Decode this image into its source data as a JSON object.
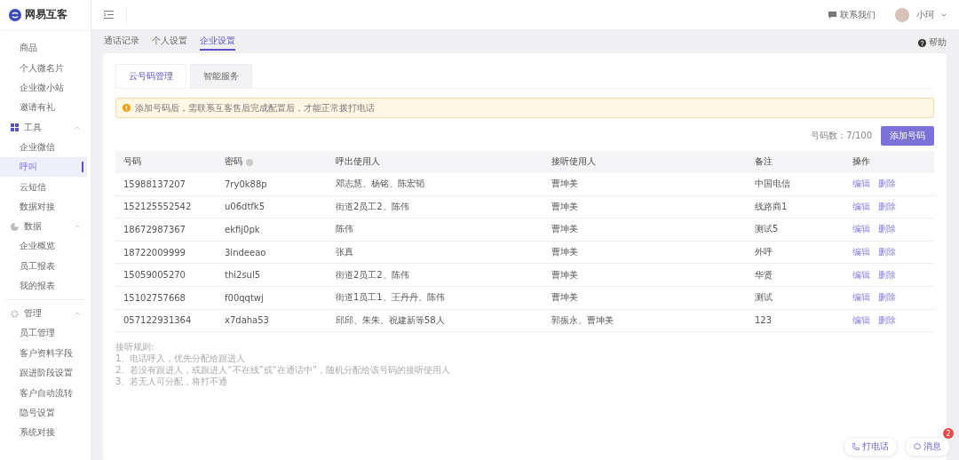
{
  "brand": {
    "name": "网易互客"
  },
  "header": {
    "contact": "联系我们",
    "user": "小珂"
  },
  "sidebar": {
    "sections": [
      {
        "items": [
          {
            "label": "商品",
            "selected": false
          },
          {
            "label": "个人微名片",
            "selected": false
          },
          {
            "label": "企业微小站",
            "selected": false
          },
          {
            "label": "邀请有礼",
            "selected": false
          }
        ]
      },
      {
        "title": "工具",
        "expanded": true,
        "items": [
          {
            "label": "企业微信",
            "selected": false
          },
          {
            "label": "呼叫",
            "selected": true
          },
          {
            "label": "云短信",
            "selected": false
          },
          {
            "label": "数据对接",
            "selected": false
          }
        ]
      },
      {
        "title": "数据",
        "expanded": true,
        "items": [
          {
            "label": "企业概览",
            "selected": false
          },
          {
            "label": "员工报表",
            "selected": false
          },
          {
            "label": "我的报表",
            "selected": false
          }
        ]
      },
      {
        "title": "管理",
        "expanded": true,
        "items": [
          {
            "label": "员工管理",
            "selected": false
          },
          {
            "label": "客户资料字段",
            "selected": false
          },
          {
            "label": "跟进阶段设置",
            "selected": false
          },
          {
            "label": "客户自动流转",
            "selected": false
          },
          {
            "label": "隐号设置",
            "selected": false
          },
          {
            "label": "系统对接",
            "selected": false
          }
        ]
      }
    ]
  },
  "page_tabs": [
    {
      "label": "通话记录",
      "selected": false
    },
    {
      "label": "个人设置",
      "selected": false
    },
    {
      "label": "企业设置",
      "selected": true
    }
  ],
  "help": "帮助",
  "card_tabs": [
    {
      "label": "云号码管理",
      "selected": true
    },
    {
      "label": "智能服务",
      "selected": false
    }
  ],
  "alert": "添加号码后，需联系互客售后完成配置后，才能正常拨打电话",
  "count": {
    "label": "号码数：",
    "value": "7/100"
  },
  "add_button": "添加号码",
  "table": {
    "columns": [
      "号码",
      "密码",
      "呼出使用人",
      "接听使用人",
      "备注",
      "操作"
    ],
    "rows": [
      {
        "cells": [
          "15988137207",
          "7ry0k88p",
          "邓志慧、杨铭、陈宏韬",
          "曹坤美",
          "中国电信"
        ],
        "actions": [
          "编辑",
          "删除"
        ]
      },
      {
        "cells": [
          "152125552542",
          "u06dtfk5",
          "街道2员工2、陈伟",
          "曹坤美",
          "线路商1"
        ],
        "actions": [
          "编辑",
          "删除"
        ]
      },
      {
        "cells": [
          "18672987367",
          "ekfij0pk",
          "陈伟",
          "曹坤美",
          "测试5"
        ],
        "actions": [
          "编辑",
          "删除"
        ]
      },
      {
        "cells": [
          "18722009999",
          "3indeeao",
          "张真",
          "曹坤美",
          "外呼"
        ],
        "actions": [
          "编辑",
          "删除"
        ]
      },
      {
        "cells": [
          "15059005270",
          "thi2sul5",
          "街道2员工2、陈伟",
          "曹坤美",
          "华贤"
        ],
        "actions": [
          "编辑",
          "删除"
        ]
      },
      {
        "cells": [
          "15102757668",
          "f00qqtwj",
          "街道1员工1、王丹丹、陈伟",
          "曹坤美",
          "测试"
        ],
        "actions": [
          "编辑",
          "删除"
        ]
      },
      {
        "cells": [
          "057122931364",
          "x7daha53",
          "邱邱、朱朱、祝建新等58人",
          "郭振永、曹坤美",
          "123"
        ],
        "actions": [
          "编辑",
          "删除"
        ]
      }
    ]
  },
  "rules": [
    "接听规则:",
    "1、电话呼入，优先分配给跟进人",
    "2、若没有跟进人，或跟进人“不在线”或“在通话中”，随机分配给该号码的接听使用人",
    "3、若无人可分配，将打不通"
  ],
  "float_buttons": [
    {
      "kind": "call",
      "label": "打电话"
    },
    {
      "kind": "message",
      "label": "消息",
      "badge": "2"
    }
  ]
}
